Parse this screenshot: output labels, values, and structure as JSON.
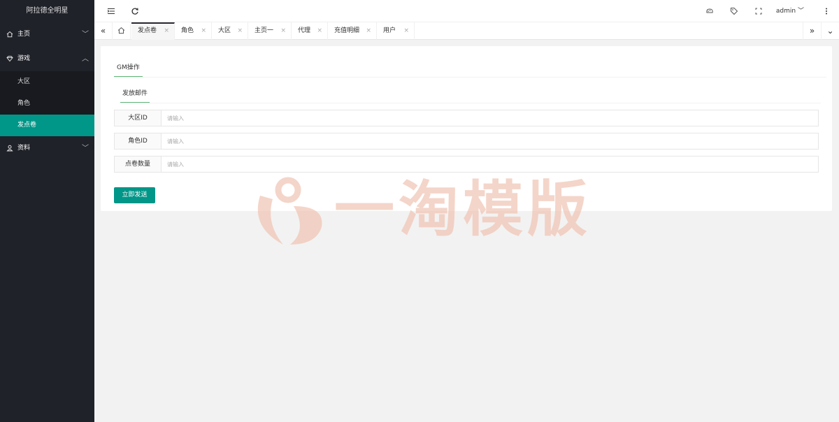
{
  "app": {
    "title": "阿拉德全明星"
  },
  "sidebar": {
    "items": [
      {
        "label": "主页",
        "icon": "home-icon",
        "arrow": "﹀"
      },
      {
        "label": "游戏",
        "icon": "diamond-icon",
        "arrow": "︿",
        "children": [
          {
            "label": "大区"
          },
          {
            "label": "角色"
          },
          {
            "label": "发点卷",
            "active": true
          }
        ]
      },
      {
        "label": "资料",
        "icon": "user-icon",
        "arrow": "﹀"
      }
    ]
  },
  "topbar": {
    "user": "admin",
    "icons": [
      "menu-fold-icon",
      "refresh-icon",
      "theme-icon",
      "tag-icon",
      "fullscreen-icon",
      "more-icon"
    ]
  },
  "tabs": {
    "items": [
      {
        "label": "发点卷",
        "active": true
      },
      {
        "label": "角色"
      },
      {
        "label": "大区"
      },
      {
        "label": "主页一"
      },
      {
        "label": "代理"
      },
      {
        "label": "充值明细"
      },
      {
        "label": "用户"
      }
    ],
    "close_glyph": "×"
  },
  "content": {
    "outer_tab": "GM操作",
    "inner_tab": "发放邮件",
    "form": {
      "fields": [
        {
          "label": "大区ID",
          "placeholder": "请输入",
          "value": ""
        },
        {
          "label": "角色ID",
          "placeholder": "请输入",
          "value": ""
        },
        {
          "label": "点卷数量",
          "placeholder": "请输入",
          "value": ""
        }
      ],
      "submit_label": "立即发送"
    }
  },
  "watermark": {
    "text": "一淘模版"
  },
  "colors": {
    "sidebar_bg": "#20222a",
    "accent": "#009688",
    "tab_underline": "#5fb878",
    "page_bg": "#f2f2f2"
  }
}
